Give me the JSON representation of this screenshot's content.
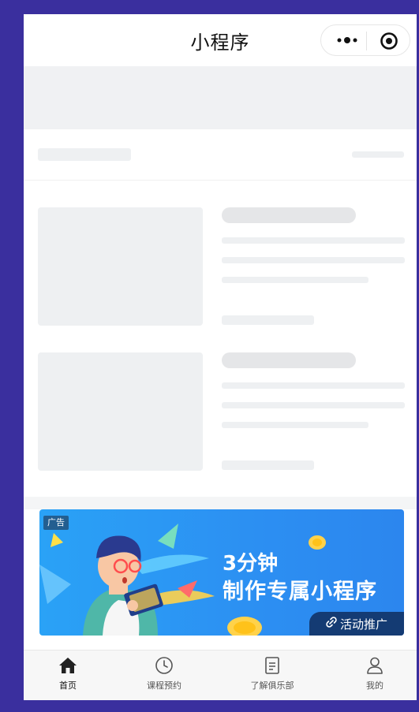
{
  "navbar": {
    "title": "小程序",
    "more_icon": "more-dots-icon",
    "home_icon": "target-circle-icon"
  },
  "ad": {
    "tag": "广告",
    "line1": "3分钟",
    "line2": "制作专属小程序",
    "promo_label": "活动推广"
  },
  "tabbar": {
    "items": [
      {
        "label": "首页",
        "icon": "home-icon"
      },
      {
        "label": "课程预约",
        "icon": "clock-icon"
      },
      {
        "label": "了解俱乐部",
        "icon": "document-icon"
      },
      {
        "label": "我的",
        "icon": "user-icon"
      }
    ]
  }
}
